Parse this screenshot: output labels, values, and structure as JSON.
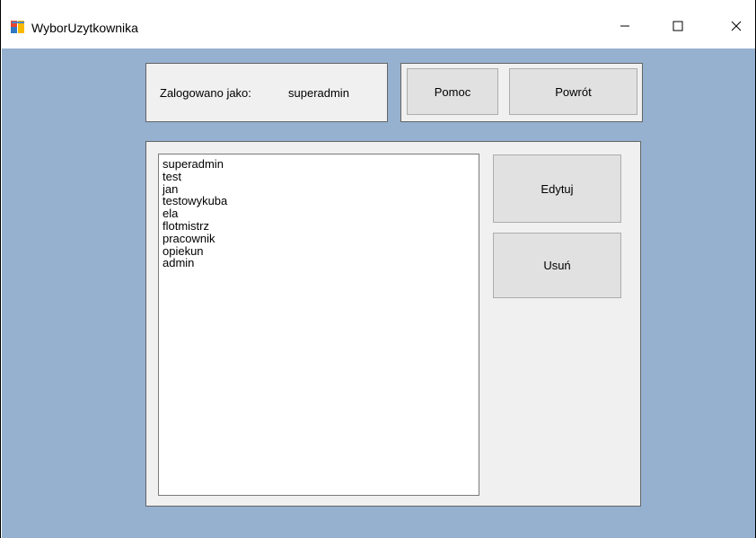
{
  "window": {
    "title": "WyborUzytkownika",
    "icon": "windows-form-icon",
    "controls": [
      "minimize-icon",
      "maximize-icon",
      "close-icon"
    ]
  },
  "login": {
    "label": "Zalogowano jako:",
    "username": "superadmin"
  },
  "toolbar": {
    "help_label": "Pomoc",
    "back_label": "Powrót"
  },
  "users": {
    "items": [
      "superadmin",
      "test",
      "jan",
      "testowykuba",
      "ela",
      "flotmistrz",
      "pracownik",
      "opiekun",
      "admin"
    ]
  },
  "actions": {
    "edit_label": "Edytuj",
    "delete_label": "Usuń"
  },
  "colors": {
    "client_background": "#95b1cf",
    "panel_background": "#f0f0f0",
    "button_background": "#e1e1e1"
  }
}
